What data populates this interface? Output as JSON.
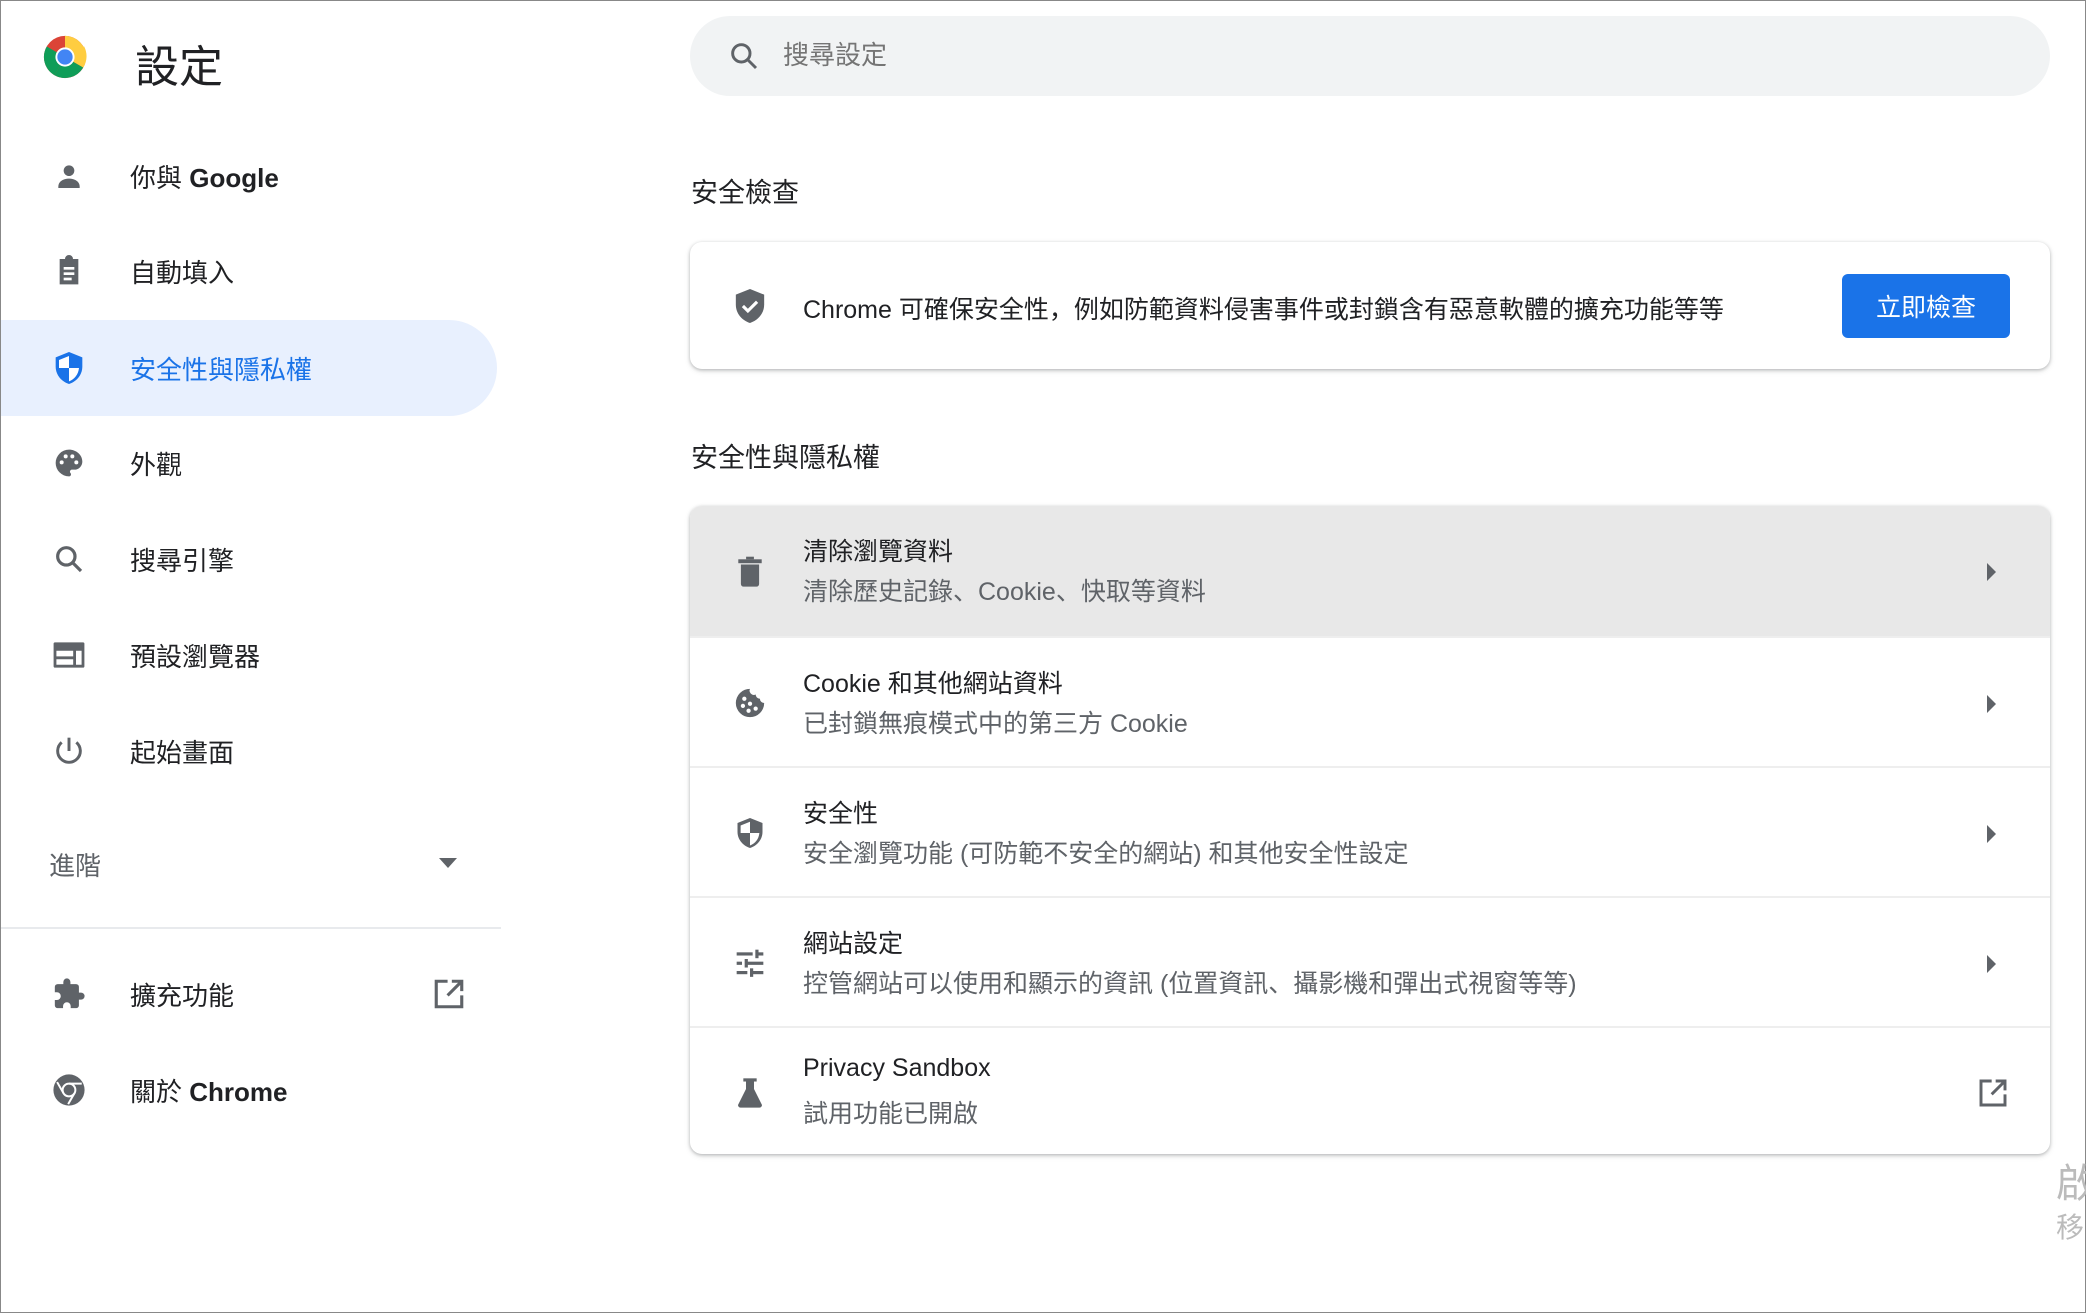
{
  "header": {
    "title": "設定",
    "logo_icon": "chrome-logo-icon"
  },
  "search": {
    "placeholder": "搜尋設定",
    "value": "",
    "icon": "search-icon"
  },
  "sidebar": {
    "items": [
      {
        "label_cn": "你與 ",
        "label_bold": "Google",
        "icon": "person-icon",
        "active": false
      },
      {
        "label_cn": "自動填入",
        "label_bold": "",
        "icon": "clipboard-icon",
        "active": false
      },
      {
        "label_cn": "安全性與隱私權",
        "label_bold": "",
        "icon": "shield-icon",
        "active": true
      },
      {
        "label_cn": "外觀",
        "label_bold": "",
        "icon": "palette-icon",
        "active": false
      },
      {
        "label_cn": "搜尋引擎",
        "label_bold": "",
        "icon": "search-icon",
        "active": false
      },
      {
        "label_cn": "預設瀏覽器",
        "label_bold": "",
        "icon": "browser-window-icon",
        "active": false
      },
      {
        "label_cn": "起始畫面",
        "label_bold": "",
        "icon": "power-icon",
        "active": false
      }
    ],
    "advanced_label": "進階",
    "bottom_items": [
      {
        "label_cn": "擴充功能",
        "label_bold": "",
        "icon": "puzzle-icon",
        "external": true
      },
      {
        "label_cn": "關於 ",
        "label_bold": "Chrome",
        "icon": "chrome-icon",
        "external": false
      }
    ]
  },
  "safety_check": {
    "heading": "安全檢查",
    "description": "Chrome 可確保安全性，例如防範資料侵害事件或封鎖含有惡意軟體的擴充功能等等",
    "button_label": "立即檢查"
  },
  "privacy": {
    "heading": "安全性與隱私權",
    "rows": [
      {
        "title": "清除瀏覽資料",
        "subtitle": "清除歷史記錄、Cookie、快取等資料",
        "icon": "trash-icon",
        "action": "arrow"
      },
      {
        "title": "Cookie 和其他網站資料",
        "subtitle": "已封鎖無痕模式中的第三方 Cookie",
        "icon": "cookie-icon",
        "action": "arrow"
      },
      {
        "title": "安全性",
        "subtitle": "安全瀏覽功能 (可防範不安全的網站) 和其他安全性設定",
        "icon": "shield-icon",
        "action": "arrow"
      },
      {
        "title": "網站設定",
        "subtitle": "控管網站可以使用和顯示的資訊 (位置資訊、攝影機和彈出式視窗等等)",
        "icon": "tune-icon",
        "action": "arrow"
      },
      {
        "title": "Privacy Sandbox",
        "subtitle": "試用功能已開啟",
        "icon": "flask-icon",
        "action": "external"
      }
    ]
  },
  "watermark": {
    "line1": "啟",
    "line2": "移"
  },
  "colors": {
    "accent": "#1a73e8",
    "active_bg": "#e8f0fe",
    "icon": "#5f6368"
  }
}
